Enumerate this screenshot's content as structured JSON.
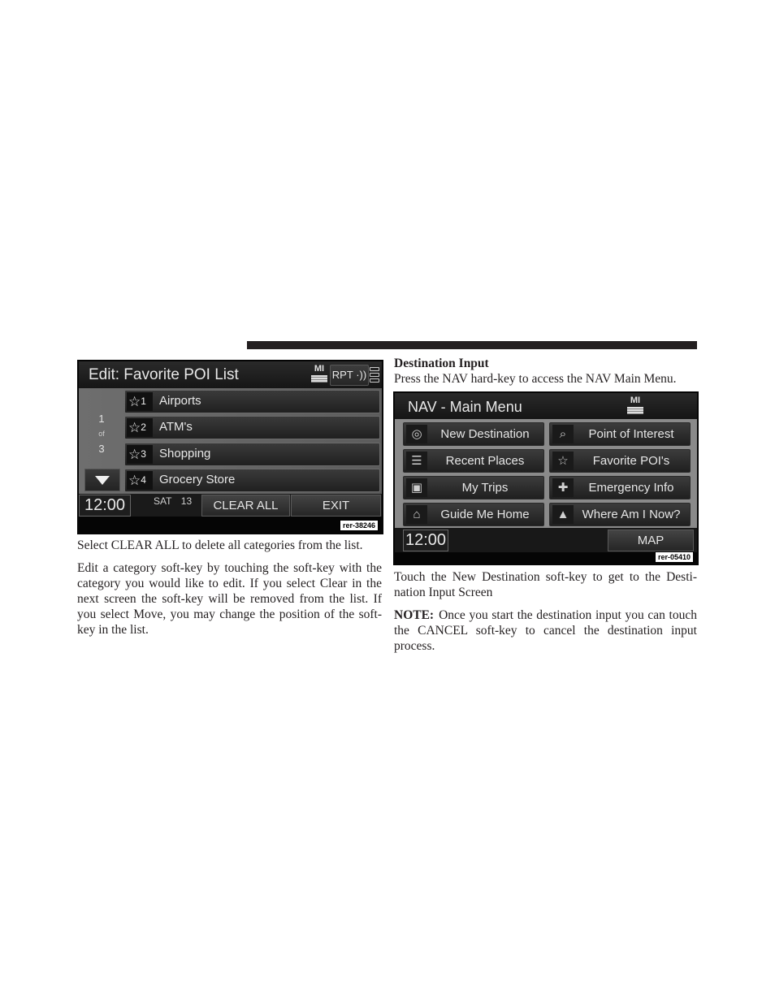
{
  "screen_edit_poi": {
    "title": "Edit: Favorite POI List",
    "distance_unit": "MI",
    "rpt_button": "RPT",
    "pager": {
      "current": "1",
      "of": "of",
      "total": "3"
    },
    "items": [
      {
        "num": "1",
        "label": "Airports",
        "icon": "star-icon"
      },
      {
        "num": "2",
        "label": "ATM's",
        "icon": "star-icon"
      },
      {
        "num": "3",
        "label": "Shopping",
        "icon": "star-icon"
      },
      {
        "num": "4",
        "label": "Grocery Store",
        "icon": "star-icon"
      }
    ],
    "clock": "12:00",
    "day": "SAT",
    "date": "13",
    "clear_all": "CLEAR ALL",
    "exit": "EXIT",
    "ref": "rer-38246"
  },
  "screen_nav_menu": {
    "title": "NAV - Main Menu",
    "distance_unit": "MI",
    "buttons": [
      {
        "label": "New Destination",
        "icon": "destination-icon",
        "glyph": "◎"
      },
      {
        "label": "Point of Interest",
        "icon": "poi-search-icon",
        "glyph": "⌕"
      },
      {
        "label": "Recent Places",
        "icon": "list-icon",
        "glyph": "☰"
      },
      {
        "label": "Favorite POI's",
        "icon": "star-icon",
        "glyph": "☆"
      },
      {
        "label": "My Trips",
        "icon": "briefcase-icon",
        "glyph": "▣"
      },
      {
        "label": "Emergency Info",
        "icon": "cross-icon",
        "glyph": "✚"
      },
      {
        "label": "Guide Me Home",
        "icon": "home-icon",
        "glyph": "⌂"
      },
      {
        "label": "Where Am I Now?",
        "icon": "compass-icon",
        "glyph": "▲"
      }
    ],
    "clock": "12:00",
    "map": "MAP",
    "ref": "rer-05410"
  },
  "left_text": {
    "p1": "Select CLEAR ALL to delete all categories from the list.",
    "p2": "Edit a category soft-key by touching the soft-key with the category you would like to edit. If you select Clear in the next screen the soft-key will be removed from the list. If you select Move, you may change the position of the soft-key in the list."
  },
  "right_text": {
    "heading": "Destination Input",
    "intro": "Press the NAV hard-key to access the NAV Main Menu.",
    "p1": "Touch the New Destination soft-key to get to the Desti- nation Input Screen",
    "note_label": "NOTE:",
    "note": "Once you start the destination input you can touch the CANCEL soft-key to cancel the destination input process."
  }
}
